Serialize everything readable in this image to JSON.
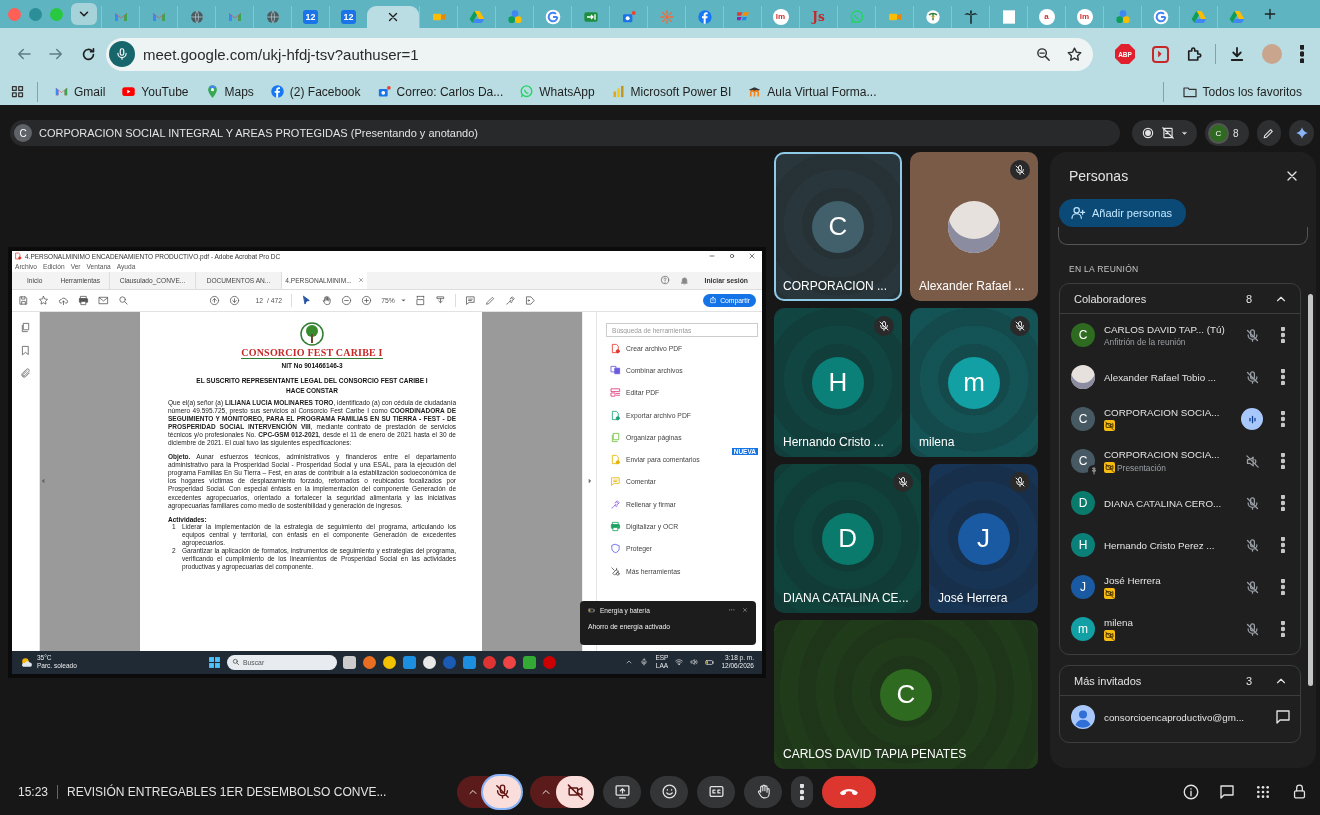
{
  "browser": {
    "tabs": [
      {
        "selected": false
      },
      {
        "selected": false
      },
      {
        "selected": false
      },
      {
        "selected": false
      },
      {
        "selected": false
      },
      {
        "label": "12",
        "selected": false
      },
      {
        "label": "12",
        "selected": false
      },
      {
        "selected": true
      },
      {
        "selected": false
      },
      {
        "selected": false
      },
      {
        "selected": false
      },
      {
        "selected": false
      },
      {
        "selected": false
      },
      {
        "selected": false
      },
      {
        "selected": false
      },
      {
        "selected": false
      },
      {
        "selected": false
      },
      {
        "label": "lm",
        "selected": false
      },
      {
        "label": "Js",
        "selected": false
      },
      {
        "selected": false
      },
      {
        "selected": false
      },
      {
        "selected": false
      },
      {
        "selected": false
      },
      {
        "selected": false
      },
      {
        "label": "a",
        "selected": false
      },
      {
        "label": "lm",
        "selected": false
      },
      {
        "selected": false
      },
      {
        "selected": false
      },
      {
        "selected": false
      },
      {
        "selected": false
      }
    ],
    "url": "meet.google.com/ukj-hfdj-tsv?authuser=1",
    "extension_badge": "ABP",
    "bookmarks": [
      {
        "label": "Gmail"
      },
      {
        "label": "YouTube"
      },
      {
        "label": "Maps"
      },
      {
        "label": "(2) Facebook"
      },
      {
        "label": "Correo: Carlos Da..."
      },
      {
        "label": "WhatsApp"
      },
      {
        "label": "Microsoft Power BI"
      },
      {
        "label": "Aula Virtual Forma..."
      }
    ],
    "all_bookmarks": "Todos los favoritos"
  },
  "meet": {
    "title": "CORPORACION SOCIAL INTEGRAL Y AREAS PROTEGIDAS (Presentando y anotando)",
    "presenter_initial": "C",
    "people_avatar_initial": "C",
    "people_count": "8"
  },
  "shared_screen": {
    "window_title": "4.PERSONALMINIMO ENCADENAMIENTO PRODUCTIVO.pdf - Adobe Acrobat Pro DC",
    "menu": [
      "Archivo",
      "Edición",
      "Ver",
      "Ventana",
      "Ayuda"
    ],
    "tabs": [
      {
        "label": "Inicio",
        "kind": "nav",
        "selected": false
      },
      {
        "label": "Herramientas",
        "kind": "nav",
        "selected": false
      },
      {
        "label": "Clausulado_CONVE...",
        "kind": "document",
        "selected": false
      },
      {
        "label": "DOCUMENTOS AN...",
        "kind": "document",
        "selected": false
      },
      {
        "label": "4.PERSONALMINIM...",
        "kind": "document",
        "selected": true
      }
    ],
    "sign_in": "Iniciar sesión",
    "page": "12",
    "page_total": "/ 472",
    "zoom": "75%",
    "share_button": "Compartir",
    "tools_search_placeholder": "Búsqueda de herramientas",
    "tools": [
      {
        "label": "Crear archivo PDF"
      },
      {
        "label": "Combinar archivos"
      },
      {
        "label": "Editar PDF"
      },
      {
        "label": "Exportar archivo PDF"
      },
      {
        "label": "Organizar páginas"
      },
      {
        "label": "Enviar para comentarios",
        "badge": "NUEVA"
      },
      {
        "label": "Comentar"
      },
      {
        "label": "Rellenar y firmar"
      },
      {
        "label": "Digitalizar y OCR"
      },
      {
        "label": "Proteger"
      },
      {
        "label": "Más herramientas"
      }
    ],
    "document": {
      "logo_text": "CONSORCIO FEST CARIBE I",
      "nit": "NIT No 901466146-3",
      "heading": "EL SUSCRITO REPRESENTANTE LEGAL DEL CONSORCIO FEST CARIBE I",
      "subheading": "HACE CONSTAR",
      "paragraphs": [
        "Que el(a) señor (a) **LILIANA LUCIA MOLINARES TORO**, identificado (a) con cédula de ciudadanía número 49.595.725, presto sus servicios al Consorcio Fest Caribe I como **COORDINADORA DE SEGUIMIENTO Y MONITOREO, PARA EL PROGRAMA FAMILIAS EN SU TIERRA - FEST - DE PROSPERIDAD SOCIAL INTERVENCIÓN VIII**, mediante contrato de prestación de servicios técnicos y/o profesionales No. **CPC-GSM 012-2021**, desde el 11 de enero de 2021 hasta el 30 de diciembre de 2021. El cual tuvo las siguientes especificaciones:",
        "**Objeto.** Aunar esfuerzos técnicos, administrativos y financieros entre el departamento administrativo para la Prosperidad Social - Prosperidad Social y una ESAL, para la ejecución del programa Familias En Su Tierra – Fest, en aras de contribuir a la estabilización socioeconómica de los hogares víctimas de desplazamiento forzado, retornados o reubicados focalizados por Prosperidad Social. Con especial énfasis en la implementación del componente Generación de excedentes agropecuarios, orientado a fortalecer la seguridad alimentaria y las iniciativas agropecuarias familiares como medio de sostenibilidad y generación de ingresos."
      ],
      "activities_title": "Actividades:",
      "activities": [
        {
          "number": "1",
          "text": "Liderar la implementación de la estrategia de seguimiento del programa, articulando los equipos central y territorial, con énfasis en el componente Generación de excedentes agropecuarios."
        },
        {
          "number": "2",
          "text": "Garantizar la aplicación de formatos, instrumentos de seguimiento y estrategias del programa, verificando el cumplimiento de los lineamientos de Prosperidad Social en las actividades productivas y agropecuarias del componente."
        }
      ]
    },
    "notification": {
      "title": "Energía y batería",
      "body": "Ahorro de energía activado"
    },
    "taskbar": {
      "temperature": "35°C",
      "weather": "Parc. soleado",
      "search_placeholder": "Buscar",
      "language": "ESP",
      "region": "LAA",
      "time": "3:18 p. m.",
      "date": "12/06/2026"
    }
  },
  "tiles": [
    {
      "name": "CORPORACION ...",
      "kind": "initial",
      "initial": "C",
      "color": "#41606b",
      "muted": false,
      "speaking": true
    },
    {
      "name": "Alexander Rafael ...",
      "kind": "photo",
      "muted": true,
      "speaking": false
    },
    {
      "name": "Hernando Cristo ...",
      "kind": "initial",
      "initial": "H",
      "color": "#0b8078",
      "muted": true,
      "speaking": false
    },
    {
      "name": "milena",
      "kind": "initial",
      "initial": "m",
      "color": "#12a0a4",
      "muted": true,
      "speaking": false
    },
    {
      "name": "DIANA CATALINA CE...",
      "kind": "initial",
      "initial": "D",
      "color": "#0a7a6c",
      "muted": true,
      "speaking": false
    },
    {
      "name": "José Herrera",
      "kind": "initial",
      "initial": "J",
      "color": "#1a5aa2",
      "muted": true,
      "speaking": false
    },
    {
      "name": "CARLOS DAVID TAPIA PENATES",
      "kind": "initial",
      "initial": "C",
      "color": "#2e6a20",
      "muted": false,
      "speaking": false
    }
  ],
  "people": {
    "title": "Personas",
    "add_button": "Añadir personas",
    "section": "EN LA REUNIÓN",
    "groups": [
      {
        "title": "Colaboradores",
        "count": "8",
        "expanded": true,
        "rows": [
          {
            "kind": "initial",
            "initial": "C",
            "color": "#2e6a20",
            "name": "CARLOS DAVID TAP... (Tú)",
            "subtitle": "Anfitrión de la reunión",
            "muted": true,
            "speaking": false,
            "sound_off": false,
            "video_off": false,
            "presenting": false
          },
          {
            "kind": "photo",
            "name": "Alexander Rafael Tobio ...",
            "muted": true,
            "speaking": false,
            "sound_off": false,
            "video_off": false,
            "presenting": false
          },
          {
            "kind": "initial",
            "initial": "C",
            "color": "#475a63",
            "name": "CORPORACION SOCIA...",
            "muted": false,
            "speaking": true,
            "sound_off": false,
            "video_off": true,
            "presenting": false
          },
          {
            "kind": "initial",
            "initial": "C",
            "color": "#475a63",
            "name": "CORPORACION SOCIA...",
            "subtitle": "Presentación",
            "muted": false,
            "speaking": false,
            "sound_off": true,
            "video_off": true,
            "presenting": true
          },
          {
            "kind": "initial",
            "initial": "D",
            "color": "#0a7a6c",
            "name": "DIANA CATALINA CERO...",
            "muted": true,
            "speaking": false,
            "sound_off": false,
            "video_off": false,
            "presenting": false
          },
          {
            "kind": "initial",
            "initial": "H",
            "color": "#0b8078",
            "name": "Hernando Cristo Perez ...",
            "muted": true,
            "speaking": false,
            "sound_off": false,
            "video_off": false,
            "presenting": false
          },
          {
            "kind": "initial",
            "initial": "J",
            "color": "#1a5aa2",
            "name": "José Herrera",
            "muted": true,
            "speaking": false,
            "sound_off": false,
            "video_off": true,
            "presenting": false
          },
          {
            "kind": "initial",
            "initial": "m",
            "color": "#12a0a4",
            "name": "milena",
            "muted": true,
            "speaking": false,
            "sound_off": false,
            "video_off": true,
            "presenting": false
          }
        ]
      },
      {
        "title": "Más invitados",
        "count": "3",
        "expanded": true,
        "rows": [
          {
            "kind": "guest",
            "name": "consorcioencaproductivo@gm..."
          }
        ]
      }
    ]
  },
  "call": {
    "time": "15:23",
    "meeting_name": "REVISIÓN ENTREGABLES 1ER DESEMBOLSO CONVE...",
    "mic_on": false,
    "camera_on": false
  }
}
